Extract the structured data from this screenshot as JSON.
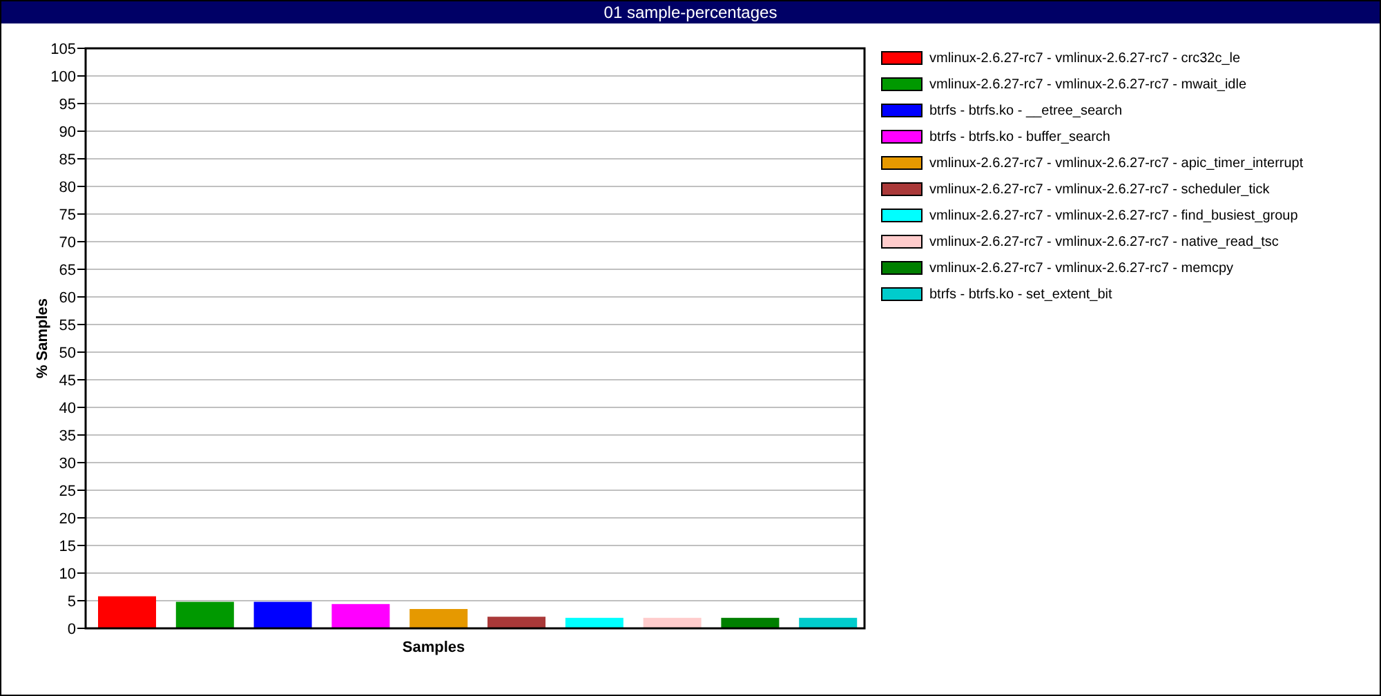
{
  "title_bar": {
    "title": "01 sample-percentages"
  },
  "chart": {
    "chart_data": {
      "type": "bar",
      "grid": true,
      "xlabel": "Samples",
      "ylabel": "% Samples",
      "ylim": [
        0,
        105
      ],
      "yticks": [
        0,
        5,
        10,
        15,
        20,
        25,
        30,
        35,
        40,
        45,
        50,
        55,
        60,
        65,
        70,
        75,
        80,
        85,
        90,
        95,
        100,
        105
      ],
      "series": [
        {
          "name": "vmlinux-2.6.27-rc7 - vmlinux-2.6.27-rc7 - crc32c_le",
          "color": "#ff0000",
          "values": [
            5.8
          ]
        },
        {
          "name": "vmlinux-2.6.27-rc7 - vmlinux-2.6.27-rc7 - mwait_idle",
          "color": "#009900",
          "values": [
            4.8
          ]
        },
        {
          "name": "btrfs - btrfs.ko - __etree_search",
          "color": "#0000ff",
          "values": [
            4.8
          ]
        },
        {
          "name": "btrfs - btrfs.ko - buffer_search",
          "color": "#ff00ff",
          "values": [
            4.4
          ]
        },
        {
          "name": "vmlinux-2.6.27-rc7 - vmlinux-2.6.27-rc7 - apic_timer_interrupt",
          "color": "#e69900",
          "values": [
            3.5
          ]
        },
        {
          "name": "vmlinux-2.6.27-rc7 - vmlinux-2.6.27-rc7 - scheduler_tick",
          "color": "#aa3939",
          "values": [
            2.1
          ]
        },
        {
          "name": "vmlinux-2.6.27-rc7 - vmlinux-2.6.27-rc7 - find_busiest_group",
          "color": "#00ffff",
          "values": [
            1.9
          ]
        },
        {
          "name": "vmlinux-2.6.27-rc7 - vmlinux-2.6.27-rc7 - native_read_tsc",
          "color": "#ffcccc",
          "values": [
            1.9
          ]
        },
        {
          "name": "vmlinux-2.6.27-rc7 - vmlinux-2.6.27-rc7 - memcpy",
          "color": "#007f00",
          "values": [
            1.9
          ]
        },
        {
          "name": "btrfs - btrfs.ko - set_extent_bit",
          "color": "#00cccc",
          "values": [
            1.9
          ]
        }
      ]
    }
  }
}
